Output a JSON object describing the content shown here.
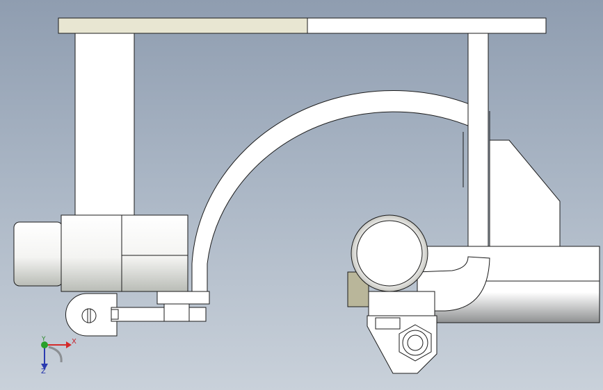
{
  "viewport": {
    "background_top": "#8f9db0",
    "background_bottom": "#c9d1da",
    "part_fill": "#ffffff",
    "edge_color": "#1a1a1a",
    "highlight_fill": "#e8e6d2"
  },
  "triad": {
    "x_label": "X",
    "y_label": "Y",
    "z_label": "Z",
    "x_color": "#d42a2a",
    "y_color": "#2aa02a",
    "z_color": "#2a3ab0"
  }
}
